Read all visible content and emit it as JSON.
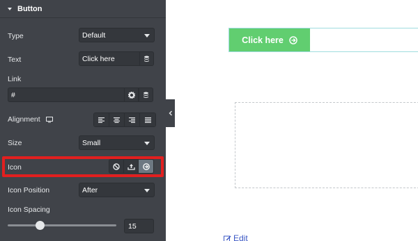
{
  "panel": {
    "section_title": "Button",
    "type": {
      "label": "Type",
      "value": "Default"
    },
    "text": {
      "label": "Text",
      "value": "Click here"
    },
    "link": {
      "label": "Link",
      "value": "#"
    },
    "alignment": {
      "label": "Alignment",
      "options": [
        "align-left",
        "align-center",
        "align-right",
        "align-justify"
      ]
    },
    "size": {
      "label": "Size",
      "value": "Small"
    },
    "icon": {
      "label": "Icon",
      "options": [
        "none",
        "upload",
        "arrow-circle-right"
      ],
      "selected": "arrow-circle-right"
    },
    "icon_position": {
      "label": "Icon Position",
      "value": "After"
    },
    "icon_spacing": {
      "label": "Icon Spacing",
      "value": "15",
      "slider_fraction": 0.3
    }
  },
  "canvas": {
    "button_label": "Click here",
    "edit_label": "Edit"
  },
  "colors": {
    "panel_bg": "#404349",
    "button_green": "#61ce70",
    "highlight_red": "#e21f1f",
    "edit_blue": "#3a57c4"
  }
}
